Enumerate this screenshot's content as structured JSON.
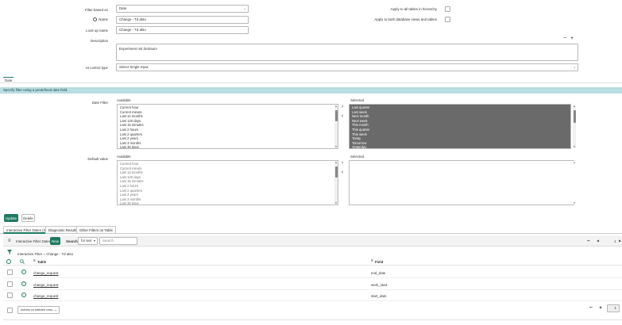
{
  "form": {
    "filter_based_on_label": "Filter based on",
    "filter_based_on_value": "Date",
    "name_label": "Name",
    "name_value": "Change - Td akto",
    "lookup_name_label": "Look up name",
    "lookup_name_value": "Change - Td akto",
    "description_label": "Description",
    "description_value": "Experiment mit Zeitraum",
    "ui_control_label": "UI control type",
    "ui_control_value": "Select Single Input",
    "apply_all_tables_label": "Apply to all tables in hierarchy",
    "apply_both_label": "Apply to both database views and tables"
  },
  "section_tab": "Date",
  "info_banner": "Specify filter using a predefined date field.",
  "date_filter": {
    "label": "Date Filter",
    "available_label": "Available",
    "selected_label": "Selected",
    "available": [
      "Current hour",
      "Current minute",
      "Last 12 months",
      "Last 120 days",
      "Last 15 minutes",
      "Last 2 hours",
      "Last 2 quarters",
      "Last 2 years",
      "Last 3 months",
      "Last 30 days"
    ],
    "selected": [
      "Last quarter",
      "Last week",
      "Next month",
      "Next week",
      "This month",
      "This quarter",
      "This week",
      "Today",
      "Tomorrow",
      "Yesterday"
    ]
  },
  "default_value": {
    "label": "Default value",
    "available_label": "Available",
    "selected_label": "Selected",
    "available": [
      "Current hour",
      "Current minute",
      "Last 12 months",
      "Last 120 days",
      "Last 15 minutes",
      "Last 2 hours",
      "Last 2 quarters",
      "Last 2 years",
      "Last 3 months",
      "Last 30 days"
    ]
  },
  "actions": {
    "update": "Update",
    "delete": "Delete"
  },
  "related_tabs": [
    "Interactive Filter Dates (3)",
    "Diagnostic Results",
    "Other Filters on Table"
  ],
  "list": {
    "title": "Interactive Filter Dates",
    "new": "New",
    "search_label": "Search",
    "search_field": "for text",
    "search_placeholder": "Search",
    "page_current": "1",
    "breadcrumb": "Interactive Filter = Change - Td akto",
    "col_table": "Table",
    "col_field": "Field",
    "rows": [
      {
        "table": "change_request",
        "field": "end_date"
      },
      {
        "table": "change_request",
        "field": "work_start"
      },
      {
        "table": "change_request",
        "field": "start_date"
      }
    ],
    "actions_placeholder": "Actions on selected rows...",
    "footer_page": "1"
  }
}
